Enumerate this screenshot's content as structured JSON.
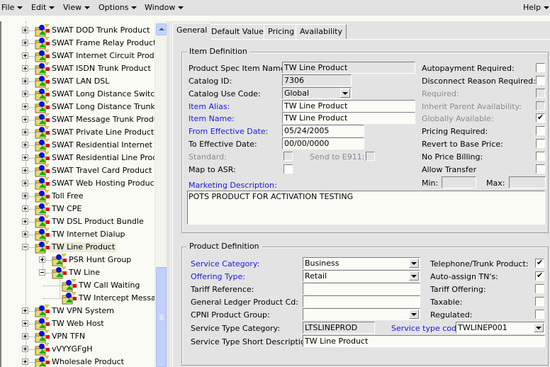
{
  "menubar": {
    "items": [
      {
        "label": "File"
      },
      {
        "label": "Edit"
      },
      {
        "label": "View"
      },
      {
        "label": "Options"
      },
      {
        "label": "Window"
      }
    ],
    "help": {
      "label": "Help"
    }
  },
  "tree": {
    "nodes": [
      {
        "label": "SWAT DOD Trunk Product",
        "level": 0,
        "expander": "plus"
      },
      {
        "label": "SWAT Frame Relay Product",
        "level": 0,
        "expander": "plus"
      },
      {
        "label": "SWAT Internet Circuit Product",
        "level": 0,
        "expander": "plus"
      },
      {
        "label": "SWAT ISDN Trunk Product",
        "level": 0,
        "expander": "plus"
      },
      {
        "label": "SWAT LAN DSL",
        "level": 0,
        "expander": "plus"
      },
      {
        "label": "SWAT Long Distance Switched",
        "level": 0,
        "expander": "plus"
      },
      {
        "label": "SWAT Long Distance Trunk Product",
        "level": 0,
        "expander": "plus"
      },
      {
        "label": "SWAT Message Trunk Product",
        "level": 0,
        "expander": "plus"
      },
      {
        "label": "SWAT Private Line Product",
        "level": 0,
        "expander": "plus"
      },
      {
        "label": "SWAT Residential Internet Dial",
        "level": 0,
        "expander": "plus"
      },
      {
        "label": "SWAT Residential Line Product",
        "level": 0,
        "expander": "plus"
      },
      {
        "label": "SWAT Travel Card Product",
        "level": 0,
        "expander": "plus"
      },
      {
        "label": "SWAT Web Hosting Product",
        "level": 0,
        "expander": "plus"
      },
      {
        "label": "Toll Free",
        "level": 0,
        "expander": "plus"
      },
      {
        "label": "TW CPE",
        "level": 0,
        "expander": "plus"
      },
      {
        "label": "TW DSL Product Bundle",
        "level": 0,
        "expander": "plus"
      },
      {
        "label": "TW Internet Dialup",
        "level": 0,
        "expander": "plus"
      },
      {
        "label": "TW Line Product",
        "level": 0,
        "expander": "minus",
        "selected": true
      },
      {
        "label": "PSR Hunt Group",
        "level": 1,
        "expander": "plus"
      },
      {
        "label": "TW Line",
        "level": 1,
        "expander": "minus"
      },
      {
        "label": "TW Call Waiting",
        "level": 2,
        "expander": "none"
      },
      {
        "label": "TW Intercept Message",
        "level": 2,
        "expander": "none"
      },
      {
        "label": "TW VPN System",
        "level": 0,
        "expander": "plus"
      },
      {
        "label": "TW Web Host",
        "level": 0,
        "expander": "plus"
      },
      {
        "label": "VPN TFN",
        "level": 0,
        "expander": "plus"
      },
      {
        "label": "vVYYGFgH",
        "level": 0,
        "expander": "plus"
      },
      {
        "label": "Wholesale Product",
        "level": 0,
        "expander": "plus"
      }
    ]
  },
  "tabs": [
    {
      "label": "General",
      "active": true
    },
    {
      "label": "Default Values"
    },
    {
      "label": "Pricing"
    },
    {
      "label": "Availability"
    }
  ],
  "item_definition": {
    "title": "Item Definition",
    "product_spec_item_name": {
      "label": "Product Spec Item Name:",
      "value": "TW Line Product"
    },
    "catalog_id": {
      "label": "Catalog ID:",
      "value": "7306"
    },
    "catalog_use_code": {
      "label": "Catalog Use Code:",
      "value": "Global"
    },
    "item_alias": {
      "label": "Item Alias:",
      "value": "TW Line Product"
    },
    "item_name": {
      "label": "Item Name:",
      "value": "TW Line Product"
    },
    "from_effective_date": {
      "label": "From Effective Date:",
      "value": "05/24/2005"
    },
    "to_effective_date": {
      "label": "To Effective Date:",
      "value": "00/00/0000"
    },
    "standard": {
      "label": "Standard:",
      "checked": false
    },
    "send_to_e911": {
      "label": "Send to E911:",
      "checked": false
    },
    "map_to_asr": {
      "label": "Map to ASR:",
      "checked": false
    },
    "marketing_description": {
      "label": "Marketing Description:",
      "value": "POTS PRODUCT FOR ACTIVATION TESTING"
    },
    "autopayment_required": {
      "label": "Autopayment Required:",
      "checked": false
    },
    "disconnect_reason_required": {
      "label": "Disconnect Reason Required:",
      "checked": false
    },
    "required": {
      "label": "Required:",
      "checked": false
    },
    "inherit_parent_availability": {
      "label": "Inherit Parent Availability:",
      "checked": false
    },
    "globally_available": {
      "label": "Globally Available:",
      "checked": true
    },
    "pricing_required": {
      "label": "Pricing Required:",
      "checked": false
    },
    "revert_to_base_price": {
      "label": "Revert to Base Price:",
      "checked": false
    },
    "no_price_billing": {
      "label": "No Price Billing:",
      "checked": false
    },
    "allow_transfer": {
      "label": "Allow Transfer",
      "checked": false
    },
    "min": {
      "label": "Min:",
      "value": ""
    },
    "max": {
      "label": "Max:",
      "value": ""
    }
  },
  "product_definition": {
    "title": "Product Definition",
    "service_category": {
      "label": "Service Category:",
      "value": "Business"
    },
    "offering_type": {
      "label": "Offering Type:",
      "value": "Retail"
    },
    "tariff_reference": {
      "label": "Tariff Reference:",
      "value": ""
    },
    "general_ledger_product_cd": {
      "label": "General Ledger Product Cd:",
      "value": ""
    },
    "cpni_product_group": {
      "label": "CPNI Product Group:",
      "value": ""
    },
    "service_type_category": {
      "label": "Service Type Category:",
      "value": "LTSLINEPROD"
    },
    "service_type_code": {
      "label": "Service type code:",
      "value": "TWLINEP001"
    },
    "service_type_short_description": {
      "label": "Service Type Short Description:",
      "value": "TW Line Product"
    },
    "telephone_trunk_product": {
      "label": "Telephone/Trunk Product:",
      "checked": true
    },
    "auto_assign_tns": {
      "label": "Auto-assign TN's:",
      "checked": true
    },
    "tariff_offering": {
      "label": "Tariff Offering:",
      "checked": false
    },
    "taxable": {
      "label": "Taxable:",
      "checked": false
    },
    "regulated": {
      "label": "Regulated:",
      "checked": false
    }
  }
}
